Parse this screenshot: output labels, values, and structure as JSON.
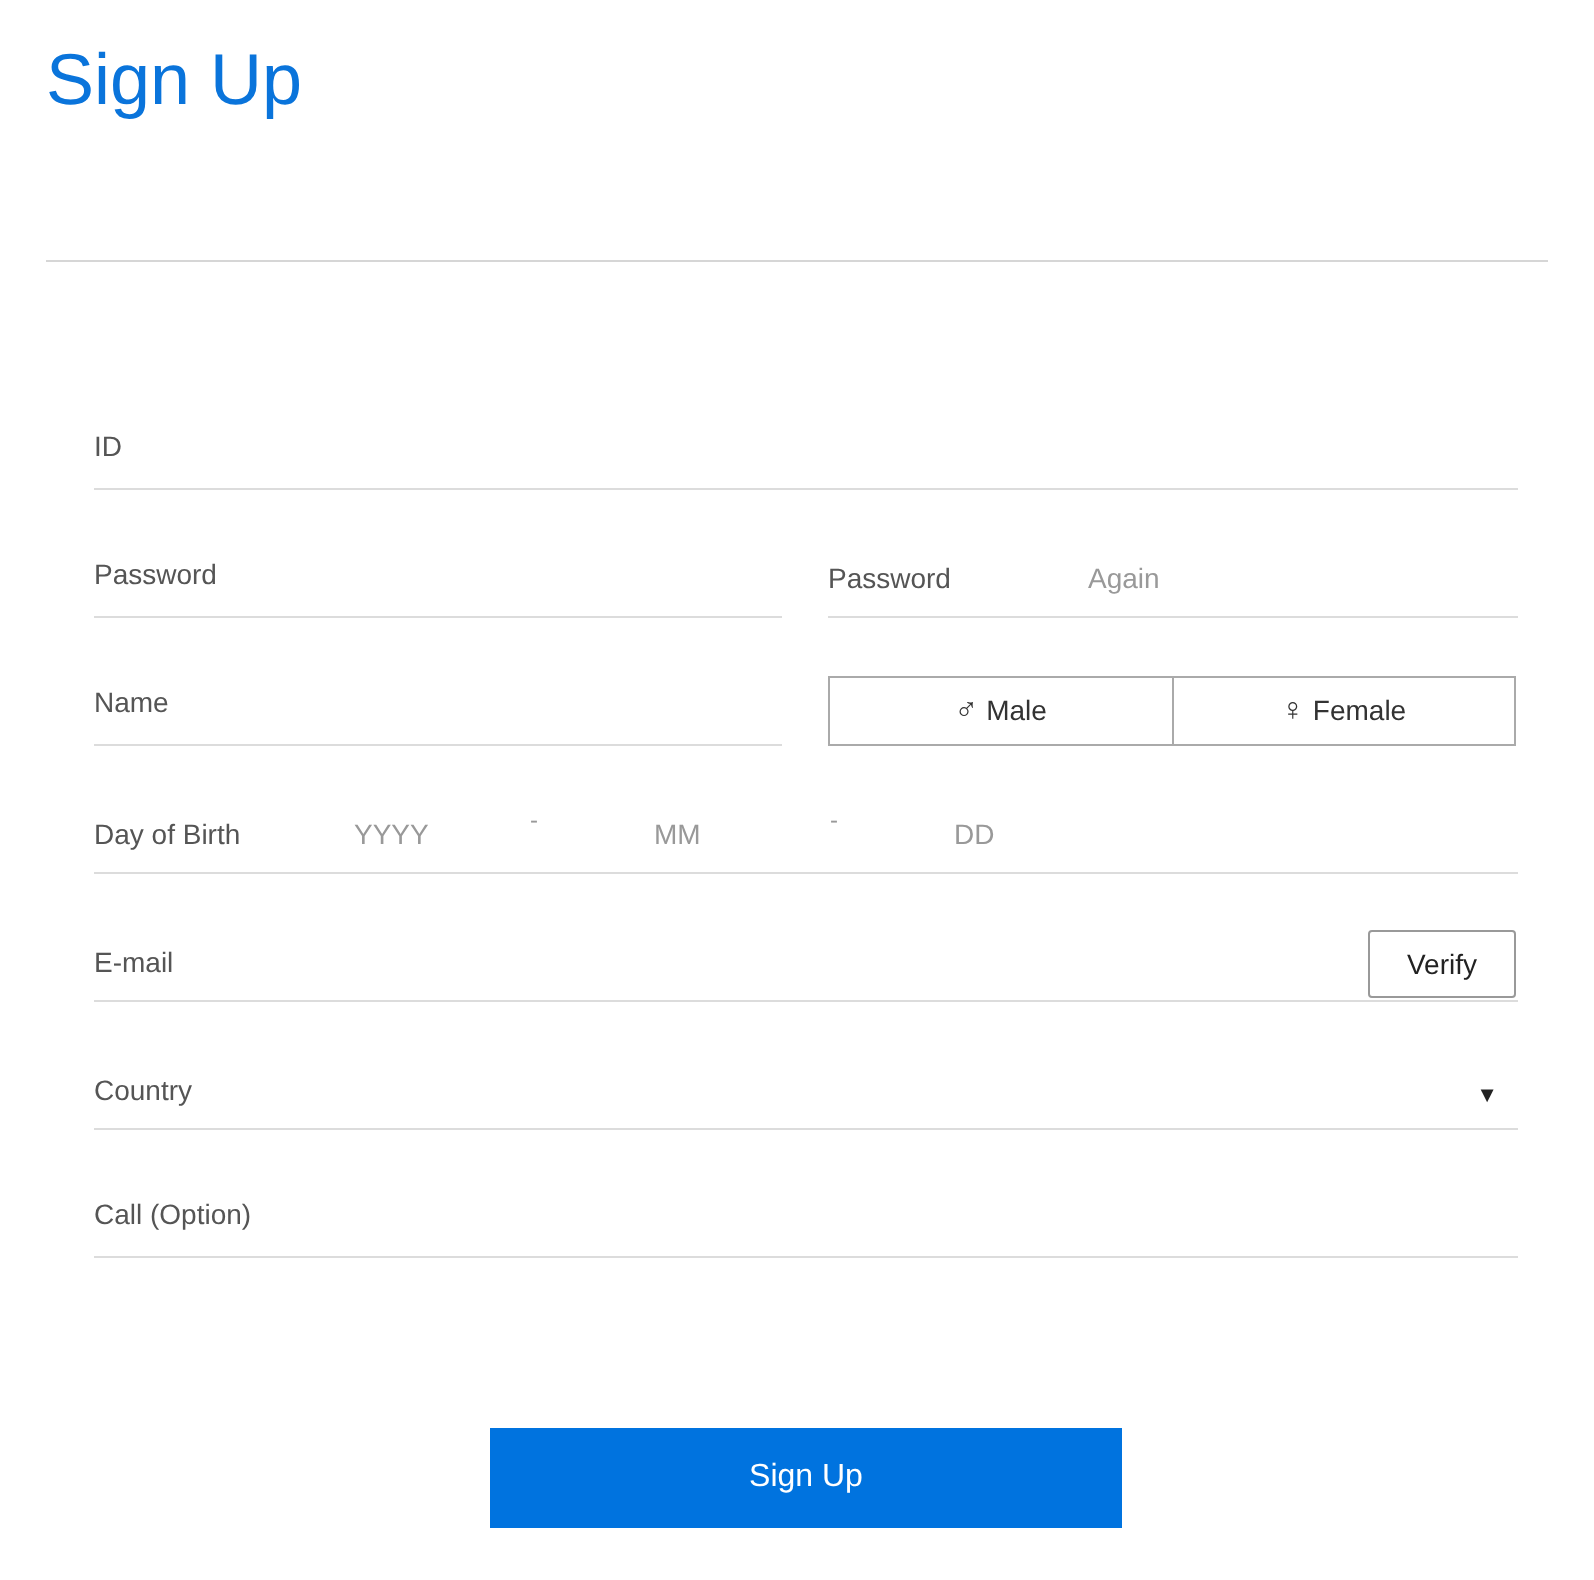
{
  "title": "Sign Up",
  "id_field": {
    "placeholder": "ID"
  },
  "password_field": {
    "placeholder": "Password"
  },
  "password_again": {
    "label": "Password",
    "placeholder": "Again"
  },
  "name_field": {
    "placeholder": "Name"
  },
  "gender": [
    {
      "symbol": "♂",
      "label": "Male",
      "selected": false
    },
    {
      "symbol": "♀",
      "label": "Female",
      "selected": false
    }
  ],
  "birth": {
    "label": "Day of Birth",
    "parts": [
      {
        "placeholder": "YYYY"
      },
      {
        "placeholder": "MM"
      },
      {
        "placeholder": "DD"
      }
    ],
    "separators": [
      "-",
      "-"
    ]
  },
  "email": {
    "placeholder": "E-mail",
    "button": "Verify"
  },
  "country": {
    "placeholder": "Country",
    "arrow": "▼"
  },
  "call": {
    "placeholder": "Call (Option)"
  },
  "submit": "Sign Up"
}
